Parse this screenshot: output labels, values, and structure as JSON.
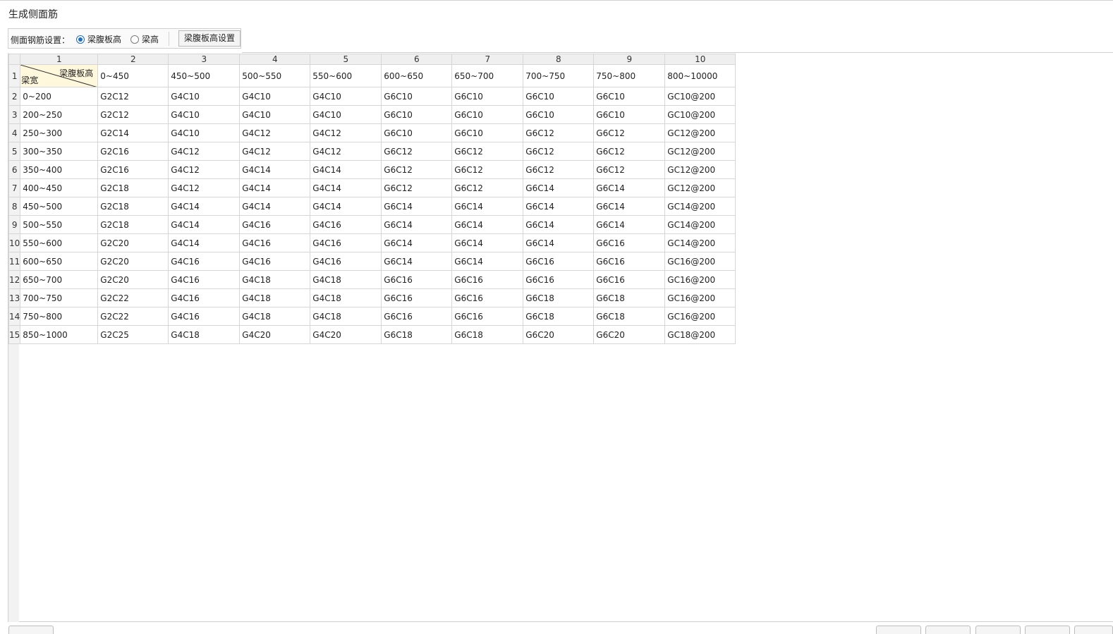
{
  "window": {
    "title": "生成侧面筋"
  },
  "toolbar": {
    "setting_label": "侧面钢筋设置：",
    "radio_options": [
      {
        "label": "梁腹板高",
        "checked": true
      },
      {
        "label": "梁高",
        "checked": false
      }
    ],
    "settings_button": "梁腹板高设置"
  },
  "grid": {
    "column_numbers": [
      "1",
      "2",
      "3",
      "4",
      "5",
      "6",
      "7",
      "8",
      "9",
      "10"
    ],
    "row_numbers": [
      "1",
      "2",
      "3",
      "4",
      "5",
      "6",
      "7",
      "8",
      "9",
      "10",
      "11",
      "12",
      "13",
      "14",
      "15"
    ],
    "corner_top_label": "梁腹板高",
    "corner_bottom_label": "梁宽",
    "header_ranges": [
      "0~450",
      "450~500",
      "500~550",
      "550~600",
      "600~650",
      "650~700",
      "700~750",
      "750~800",
      "800~10000"
    ],
    "rows": [
      {
        "range": "0~200",
        "values": [
          "G2C12",
          "G4C10",
          "G4C10",
          "G4C10",
          "G6C10",
          "G6C10",
          "G6C10",
          "G6C10",
          "GC10@200"
        ]
      },
      {
        "range": "200~250",
        "values": [
          "G2C12",
          "G4C10",
          "G4C10",
          "G4C10",
          "G6C10",
          "G6C10",
          "G6C10",
          "G6C10",
          "GC10@200"
        ]
      },
      {
        "range": "250~300",
        "values": [
          "G2C14",
          "G4C10",
          "G4C12",
          "G4C12",
          "G6C10",
          "G6C10",
          "G6C12",
          "G6C12",
          "GC12@200"
        ]
      },
      {
        "range": "300~350",
        "values": [
          "G2C16",
          "G4C12",
          "G4C12",
          "G4C12",
          "G6C12",
          "G6C12",
          "G6C12",
          "G6C12",
          "GC12@200"
        ]
      },
      {
        "range": "350~400",
        "values": [
          "G2C16",
          "G4C12",
          "G4C14",
          "G4C14",
          "G6C12",
          "G6C12",
          "G6C12",
          "G6C12",
          "GC12@200"
        ]
      },
      {
        "range": "400~450",
        "values": [
          "G2C18",
          "G4C12",
          "G4C14",
          "G4C14",
          "G6C12",
          "G6C12",
          "G6C14",
          "G6C14",
          "GC12@200"
        ]
      },
      {
        "range": "450~500",
        "values": [
          "G2C18",
          "G4C14",
          "G4C14",
          "G4C14",
          "G6C14",
          "G6C14",
          "G6C14",
          "G6C14",
          "GC14@200"
        ]
      },
      {
        "range": "500~550",
        "values": [
          "G2C18",
          "G4C14",
          "G4C16",
          "G4C16",
          "G6C14",
          "G6C14",
          "G6C14",
          "G6C14",
          "GC14@200"
        ]
      },
      {
        "range": "550~600",
        "values": [
          "G2C20",
          "G4C14",
          "G4C16",
          "G4C16",
          "G6C14",
          "G6C14",
          "G6C14",
          "G6C16",
          "GC14@200"
        ]
      },
      {
        "range": "600~650",
        "values": [
          "G2C20",
          "G4C16",
          "G4C16",
          "G4C16",
          "G6C14",
          "G6C14",
          "G6C16",
          "G6C16",
          "GC16@200"
        ]
      },
      {
        "range": "650~700",
        "values": [
          "G2C20",
          "G4C16",
          "G4C18",
          "G4C18",
          "G6C16",
          "G6C16",
          "G6C16",
          "G6C16",
          "GC16@200"
        ]
      },
      {
        "range": "700~750",
        "values": [
          "G2C22",
          "G4C16",
          "G4C18",
          "G4C18",
          "G6C16",
          "G6C16",
          "G6C18",
          "G6C18",
          "GC16@200"
        ]
      },
      {
        "range": "750~800",
        "values": [
          "G2C22",
          "G4C16",
          "G4C18",
          "G4C18",
          "G6C16",
          "G6C16",
          "G6C18",
          "G6C18",
          "GC16@200"
        ]
      },
      {
        "range": "850~1000",
        "values": [
          "G2C25",
          "G4C18",
          "G4C20",
          "G4C20",
          "G6C18",
          "G6C18",
          "G6C20",
          "G6C20",
          "GC18@200"
        ]
      }
    ]
  },
  "colors": {
    "accent": "#1f6fc8",
    "corner_fill": "#fff8dc",
    "header_fill": "#efefef",
    "grid_line": "#d6d6d6"
  }
}
